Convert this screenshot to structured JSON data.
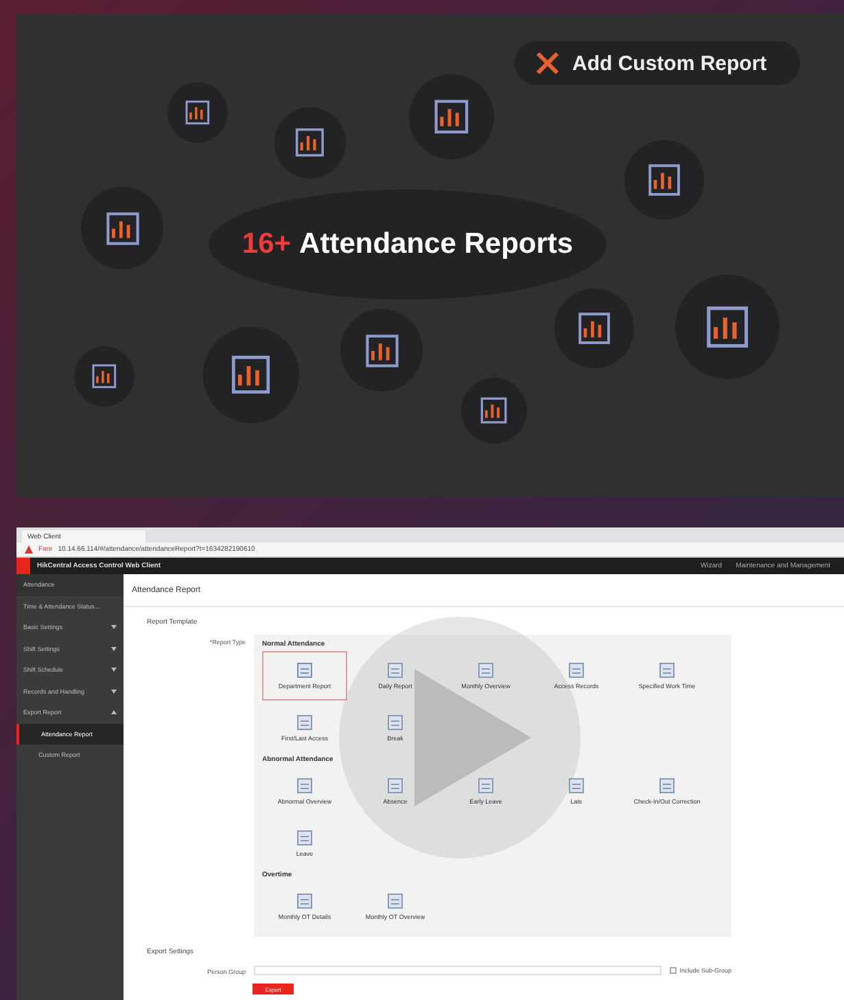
{
  "promo": {
    "count": "16+",
    "headline": "Attendance Reports",
    "custom_button": "Add Custom Report"
  },
  "browser": {
    "tab_title": "Web Client",
    "security_label": "Fare",
    "url": "10.14.66.114/#/attendance/attendanceReport?t=1634282190610"
  },
  "app": {
    "title": "HikCentral Access Control Web Client",
    "header_links": [
      "Wizard",
      "Maintenance and Management"
    ],
    "sidebar": {
      "title": "Attendance",
      "items": [
        {
          "kind": "link",
          "label": "Time & Attendance Status..."
        },
        {
          "kind": "group",
          "label": "Basic Settings",
          "expanded": false
        },
        {
          "kind": "group",
          "label": "Shift Settings",
          "expanded": false
        },
        {
          "kind": "group",
          "label": "Shift Schedule",
          "expanded": false
        },
        {
          "kind": "group",
          "label": "Records and Handling",
          "expanded": false
        },
        {
          "kind": "group",
          "label": "Export Report",
          "expanded": true,
          "children": [
            {
              "label": "Attendance Report",
              "selected": true
            },
            {
              "label": "Custom Report",
              "selected": false
            }
          ]
        }
      ]
    },
    "page_title": "Attendance Report",
    "section": "Report Template",
    "report_type_label": "*Report Type",
    "groups": [
      {
        "title": "Normal Attendance",
        "items": [
          {
            "label": "Department Report",
            "selected": true
          },
          {
            "label": "Daily Report",
            "selected": false
          },
          {
            "label": "Monthly Overview",
            "selected": false
          },
          {
            "label": "Access Records",
            "selected": false
          },
          {
            "label": "Specified Work Time",
            "selected": false
          },
          {
            "label": "First/Last Access",
            "selected": false
          },
          {
            "label": "Break",
            "selected": false
          }
        ]
      },
      {
        "title": "Abnormal Attendance",
        "items": [
          {
            "label": "Abnormal Overview",
            "selected": false
          },
          {
            "label": "Absence",
            "selected": false
          },
          {
            "label": "Early Leave",
            "selected": false
          },
          {
            "label": "Late",
            "selected": false
          },
          {
            "label": "Check-In/Out Correction",
            "selected": false
          },
          {
            "label": "Leave",
            "selected": false
          }
        ]
      },
      {
        "title": "Overtime",
        "items": [
          {
            "label": "Monthly OT Details",
            "selected": false
          },
          {
            "label": "Monthly OT Overview",
            "selected": false
          }
        ]
      }
    ],
    "export_settings": "Export Settings",
    "person_group_label": "Person Group",
    "include_sub_group": {
      "label": "Include Sub-Group",
      "checked": false
    },
    "export_button": "Export"
  }
}
